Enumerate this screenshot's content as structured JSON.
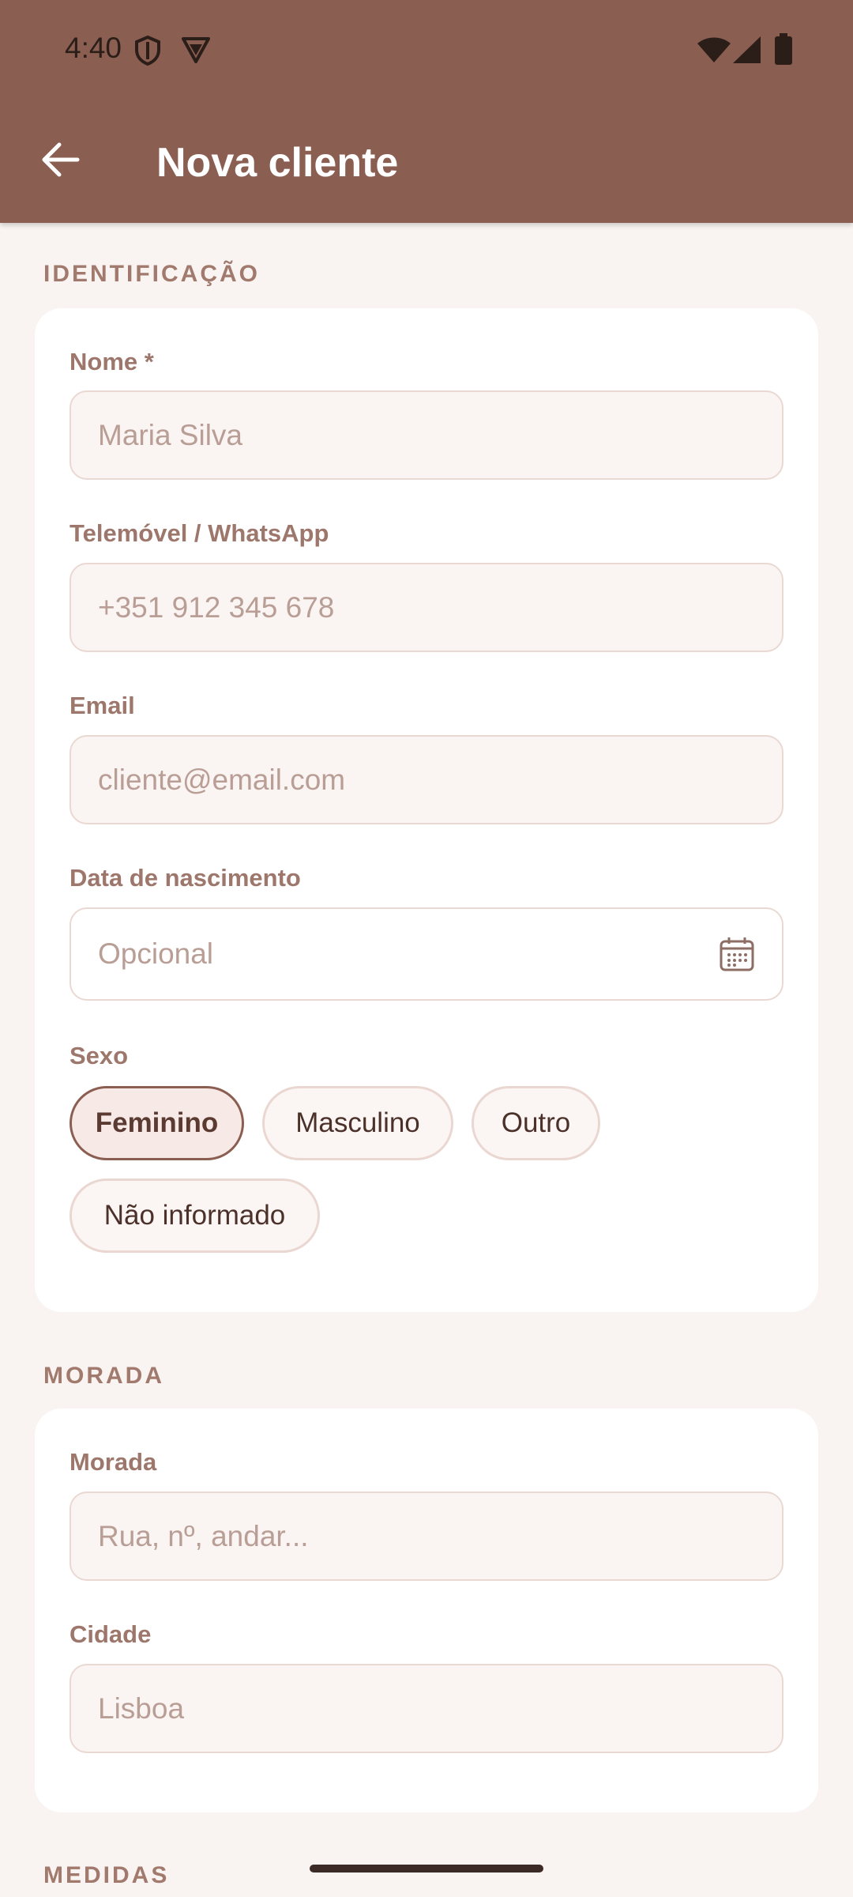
{
  "status_bar": {
    "time": "4:40"
  },
  "header": {
    "title": "Nova cliente"
  },
  "sections": {
    "identificacao": "IDENTIFICAÇÃO",
    "morada": "MORADA",
    "medidas": "MEDIDAS"
  },
  "fields": {
    "nome": {
      "label": "Nome *",
      "placeholder": "Maria Silva"
    },
    "telemovel": {
      "label": "Telemóvel / WhatsApp",
      "placeholder": "+351 912 345 678"
    },
    "email": {
      "label": "Email",
      "placeholder": "cliente@email.com"
    },
    "nascimento": {
      "label": "Data de nascimento",
      "placeholder": "Opcional"
    },
    "morada": {
      "label": "Morada",
      "placeholder": "Rua, nº, andar..."
    },
    "cidade": {
      "label": "Cidade",
      "placeholder": "Lisboa"
    }
  },
  "sexo": {
    "label": "Sexo",
    "options": [
      "Feminino",
      "Masculino",
      "Outro",
      "Não informado"
    ],
    "selected": "Feminino"
  },
  "colors": {
    "primary": "#8b5e52",
    "background": "#f9f4f2",
    "label": "#9d776b",
    "placeholder": "#b99e96"
  },
  "icons": [
    "shield-icon",
    "vpn-icon",
    "wifi-icon",
    "signal-icon",
    "battery-icon",
    "back-arrow-icon",
    "calendar-icon"
  ]
}
